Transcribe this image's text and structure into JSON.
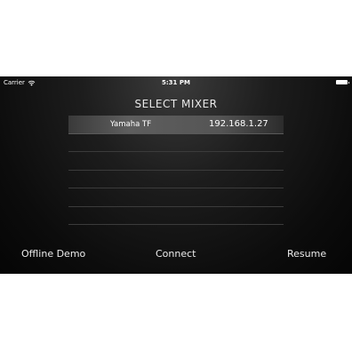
{
  "status_bar": {
    "carrier": "Carrier",
    "time": "5:31 PM",
    "icons": [
      "wifi-icon",
      "battery-icon"
    ]
  },
  "screen_title": "SELECT MIXER",
  "mixers": [
    {
      "name": "Yamaha TF",
      "ip": "192.168.1.27",
      "selected": true
    },
    {
      "name": "",
      "ip": "",
      "selected": false
    },
    {
      "name": "",
      "ip": "",
      "selected": false
    },
    {
      "name": "",
      "ip": "",
      "selected": false
    },
    {
      "name": "",
      "ip": "",
      "selected": false
    },
    {
      "name": "",
      "ip": "",
      "selected": false
    }
  ],
  "actions": {
    "offline_demo": "Offline Demo",
    "connect": "Connect",
    "resume": "Resume"
  }
}
